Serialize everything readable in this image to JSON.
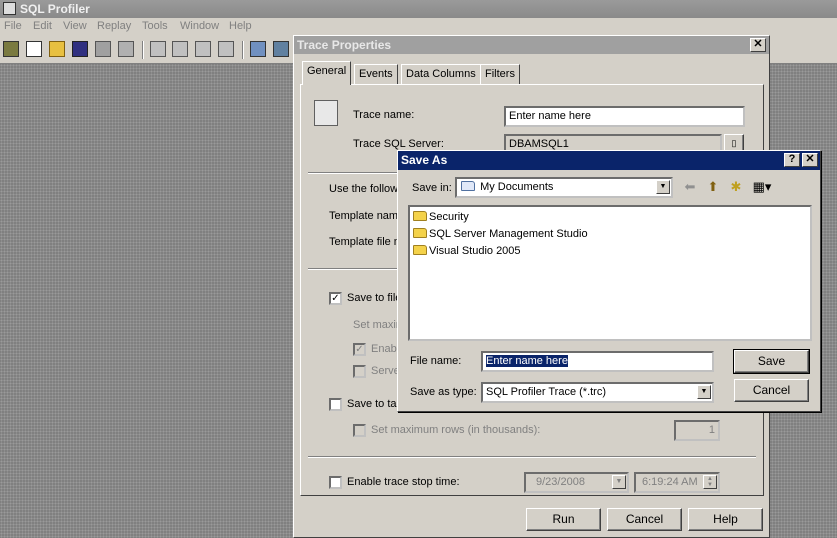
{
  "app": {
    "title": "SQL Profiler",
    "menu": [
      "File",
      "Edit",
      "View",
      "Replay",
      "Tools",
      "Window",
      "Help"
    ]
  },
  "trace_dialog": {
    "title": "Trace Properties",
    "close_label": "✕",
    "tabs": [
      "General",
      "Events",
      "Data Columns",
      "Filters"
    ],
    "active_tab": "General",
    "trace_name_label": "Trace name:",
    "trace_name_value": "Enter name  here",
    "trace_server_label": "Trace SQL Server:",
    "trace_server_value": "DBAMSQL1",
    "use_following_label": "Use the followi",
    "template_name_label": "Template nam",
    "template_file_label": "Template file n",
    "save_to_file_label": "Save to file",
    "set_max_label": "Set maxim",
    "enable_label": "Enab",
    "server_label": "Serve",
    "save_to_table_label": "Save to tal",
    "set_max_rows_label": "Set maximum rows (in thousands):",
    "max_rows_value": "1",
    "enable_stop_label": "Enable trace stop time:",
    "stop_date": "9/23/2008",
    "stop_time": "6:19:24 AM",
    "run_label": "Run",
    "cancel_label": "Cancel",
    "help_label": "Help"
  },
  "save_as": {
    "title": "Save As",
    "help_label": "?",
    "close_label": "✕",
    "save_in_label": "Save in:",
    "save_in_value": "My Documents",
    "files": [
      "Security",
      "SQL Server Management Studio",
      "Visual Studio 2005"
    ],
    "file_name_label": "File name:",
    "file_name_value": "Enter name  here",
    "save_type_label": "Save as type:",
    "save_type_value": "SQL Profiler Trace (*.trc)",
    "save_label": "Save",
    "cancel_label": "Cancel"
  }
}
